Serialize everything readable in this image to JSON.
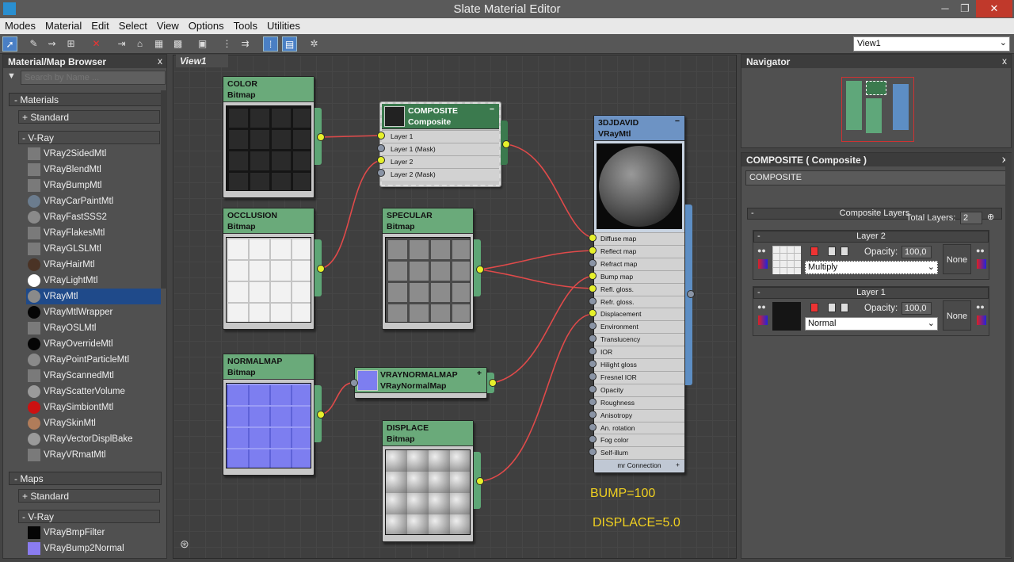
{
  "window": {
    "title": "Slate Material Editor",
    "minimize": "─",
    "restore": "❐",
    "close": "✕"
  },
  "menu": [
    "Modes",
    "Material",
    "Edit",
    "Select",
    "View",
    "Options",
    "Tools",
    "Utilities"
  ],
  "toolbar": {
    "view_select": "View1"
  },
  "browser": {
    "title": "Material/Map Browser",
    "close": "x",
    "search_placeholder": "Search by Name ...",
    "materials_header": "-  Materials",
    "standard_label": "+ Standard",
    "vray_label": "-  V-Ray",
    "materials": [
      {
        "name": "VRay2SidedMtl",
        "swatch": "#7a7a7a"
      },
      {
        "name": "VRayBlendMtl",
        "swatch": "#7a7a7a"
      },
      {
        "name": "VRayBumpMtl",
        "swatch": "#7a7a7a"
      },
      {
        "name": "VRayCarPaintMtl",
        "swatch": "#6b7c8e"
      },
      {
        "name": "VRayFastSSS2",
        "swatch": "#8a8a8a"
      },
      {
        "name": "VRayFlakesMtl",
        "swatch": "#7a7a7a"
      },
      {
        "name": "VRayGLSLMtl",
        "swatch": "#7a7a7a"
      },
      {
        "name": "VRayHairMtl",
        "swatch": "#4a3325"
      },
      {
        "name": "VRayLightMtl",
        "swatch": "#ffffff"
      },
      {
        "name": "VRayMtl",
        "swatch": "#8a8a8a"
      },
      {
        "name": "VRayMtlWrapper",
        "swatch": "#050505"
      },
      {
        "name": "VRayOSLMtl",
        "swatch": "#7a7a7a"
      },
      {
        "name": "VRayOverrideMtl",
        "swatch": "#050505"
      },
      {
        "name": "VRayPointParticleMtl",
        "swatch": "#8a8a8a"
      },
      {
        "name": "VRayScannedMtl",
        "swatch": "#7a7a7a"
      },
      {
        "name": "VRayScatterVolume",
        "swatch": "#9a9a9a"
      },
      {
        "name": "VRaySimbiontMtl",
        "swatch": "#cc1111"
      },
      {
        "name": "VRaySkinMtl",
        "swatch": "#b07c5a"
      },
      {
        "name": "VRayVectorDisplBake",
        "swatch": "#9a9a9a"
      },
      {
        "name": "VRayVRmatMtl",
        "swatch": "#7a7a7a"
      }
    ],
    "maps_header": "-  Maps",
    "maps_standard_label": "+ Standard",
    "maps_vray_label": "-  V-Ray",
    "maps": [
      {
        "name": "VRayBmpFilter",
        "swatch": "#050505"
      },
      {
        "name": "VRayBump2Normal",
        "swatch": "#8a7cf0"
      }
    ]
  },
  "view": {
    "tab": "View1"
  },
  "nodes": {
    "color": {
      "name": "COLOR",
      "type": "Bitmap"
    },
    "occlusion": {
      "name": "OCCLUSION",
      "type": "Bitmap"
    },
    "normalmap": {
      "name": "NORMALMAP",
      "type": "Bitmap"
    },
    "specular": {
      "name": "SPECULAR",
      "type": "Bitmap"
    },
    "displace": {
      "name": "DISPLACE",
      "type": "Bitmap"
    },
    "composite": {
      "name": "COMPOSITE",
      "type": "Composite",
      "minus": "−",
      "slots": [
        "Layer 1",
        "Layer 1 (Mask)",
        "Layer 2",
        "Layer 2 (Mask)"
      ]
    },
    "vraynormal": {
      "name": "VRAYNORMALMAP",
      "type": "VRayNormalMap",
      "plus": "+"
    },
    "vraymtl": {
      "name": "3DJDAVID",
      "type": "VRayMtl",
      "minus": "−",
      "slots": [
        "Diffuse map",
        "Reflect map",
        "Refract map",
        "Bump map",
        "Refl. gloss.",
        "Refr. gloss.",
        "Displacement",
        "Environment",
        "Translucency",
        "IOR",
        "Hilight gloss",
        "Fresnel IOR",
        "Opacity",
        "Roughness",
        "Anisotropy",
        "An. rotation",
        "Fog color",
        "Self-illum"
      ],
      "footer": "mr Connection",
      "footer_plus": "+"
    }
  },
  "annotations": {
    "bump": "BUMP=100",
    "displace": "DISPLACE=5.0"
  },
  "navigator": {
    "title": "Navigator",
    "close": "x"
  },
  "properties": {
    "title": "COMPOSITE  ( Composite )",
    "close": "x",
    "name_value": "COMPOSITE",
    "rollout": "Composite Layers",
    "rollout_toggle": "-",
    "total_label": "Total Layers:",
    "total_value": "2",
    "layers": [
      {
        "title": "Layer 2",
        "toggle": "-",
        "opacity_label": "Opacity:",
        "opacity": "100,0",
        "blend": "Multiply",
        "none": "None"
      },
      {
        "title": "Layer 1",
        "toggle": "-",
        "opacity_label": "Opacity:",
        "opacity": "100,0",
        "blend": "Normal",
        "none": "None"
      }
    ]
  }
}
